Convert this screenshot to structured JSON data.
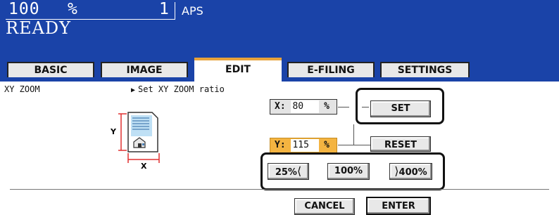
{
  "header": {
    "zoom_value": "100",
    "zoom_unit": "%",
    "copies": "1",
    "paper_mode": "APS",
    "status": "READY"
  },
  "tabs": [
    {
      "label": "BASIC",
      "active": false
    },
    {
      "label": "IMAGE",
      "active": false
    },
    {
      "label": "EDIT",
      "active": true
    },
    {
      "label": "E-FILING",
      "active": false
    },
    {
      "label": "SETTINGS",
      "active": false
    }
  ],
  "function": {
    "label": "XY ZOOM",
    "description": "Set XY ZOOM ratio"
  },
  "diagram": {
    "x_label": "X",
    "y_label": "Y",
    "icon": "document-page-icon"
  },
  "fields": {
    "x": {
      "label": "X:",
      "value": "80",
      "unit": "%"
    },
    "y": {
      "label": "Y:",
      "value": "115",
      "unit": "%"
    }
  },
  "buttons": {
    "set": "SET",
    "reset": "RESET",
    "zoom_25": "25%",
    "zoom_100": "100%",
    "zoom_400": "400%",
    "cancel": "CANCEL",
    "enter": "ENTER"
  },
  "colors": {
    "header_bg": "#1a43a8",
    "active_tab_accent": "#e8a33a",
    "active_field": "#f4b441"
  }
}
